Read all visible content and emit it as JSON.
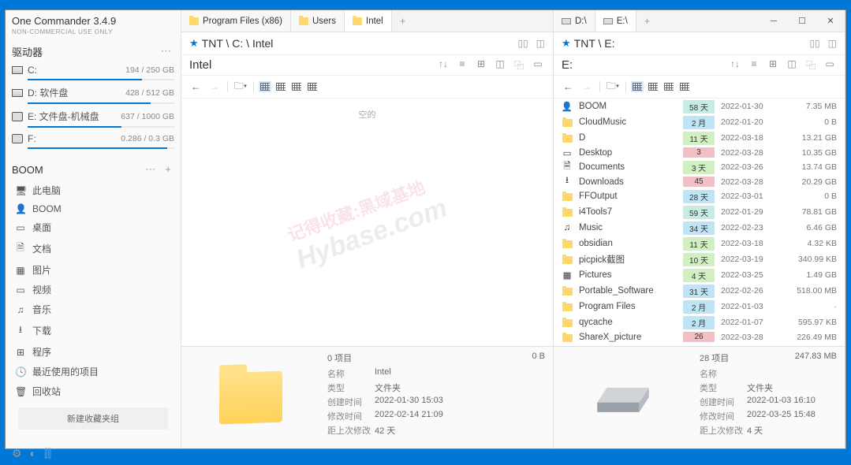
{
  "app": {
    "title": "One Commander 3.4.9",
    "subtitle": "NON-COMMERCIAL USE ONLY"
  },
  "drives": {
    "label": "驱动器",
    "items": [
      {
        "name": "C:",
        "size": "194 / 250 GB",
        "fill": 78
      },
      {
        "name": "D: 软件盘",
        "size": "428 / 512 GB",
        "fill": 84
      },
      {
        "name": "E: 文件盘-机械盘",
        "size": "637 / 1000 GB",
        "fill": 64
      },
      {
        "name": "F:",
        "size": "0.286 / 0.3 GB",
        "fill": 95
      }
    ]
  },
  "favorites": {
    "label": "BOOM",
    "items": [
      {
        "icon": "🖥",
        "label": "此电脑"
      },
      {
        "icon": "👤",
        "label": "BOOM"
      },
      {
        "icon": "▭",
        "label": "桌面"
      },
      {
        "icon": "🗎",
        "label": "文档"
      },
      {
        "icon": "▦",
        "label": "图片"
      },
      {
        "icon": "▭",
        "label": "视频"
      },
      {
        "icon": "♫",
        "label": "音乐"
      },
      {
        "icon": "⭳",
        "label": "下载"
      },
      {
        "icon": "⊞",
        "label": "程序"
      },
      {
        "icon": "🕓",
        "label": "最近使用的项目"
      },
      {
        "icon": "🗑",
        "label": "回收站"
      }
    ],
    "new_group": "新建收藏夹组"
  },
  "left": {
    "tabs": [
      {
        "label": "Program Files (x86)",
        "type": "folder"
      },
      {
        "label": "Users",
        "type": "folder"
      },
      {
        "label": "Intel",
        "type": "folder",
        "active": true
      }
    ],
    "path": "TNT \\ C: \\ Intel",
    "header": "Intel",
    "empty": "空的",
    "info": {
      "count": "0 项目",
      "size_total": "0 B",
      "rows": [
        {
          "k": "名称",
          "v": "Intel"
        },
        {
          "k": "类型",
          "v": "文件夹"
        },
        {
          "k": "创建时间",
          "v": "2022-01-30  15:03"
        },
        {
          "k": "修改时间",
          "v": "2022-02-14  21:09"
        },
        {
          "k": "距上次修改",
          "v": "42 天"
        }
      ]
    }
  },
  "right": {
    "tabs": [
      {
        "label": "D:\\",
        "type": "disk"
      },
      {
        "label": "E:\\",
        "type": "disk",
        "active": true
      }
    ],
    "path": "TNT \\ E:",
    "header": "E:",
    "files": [
      {
        "icon": "👤",
        "name": "BOOM",
        "age": "58 天",
        "agec": "age-cyan",
        "date": "2022-01-30",
        "size": "7.35 MB"
      },
      {
        "icon": "folder",
        "name": "CloudMusic",
        "age": "2 月",
        "agec": "age-blue",
        "date": "2022-01-20",
        "size": "0 B"
      },
      {
        "icon": "folder",
        "name": "D",
        "age": "11 天",
        "agec": "age-green",
        "date": "2022-03-18",
        "size": "13.21 GB"
      },
      {
        "icon": "▭",
        "name": "Desktop",
        "age": "3",
        "agec": "age-red",
        "date": "2022-03-28",
        "size": "10.35 GB"
      },
      {
        "icon": "🗎",
        "name": "Documents",
        "age": "3 天",
        "agec": "age-green",
        "date": "2022-03-26",
        "size": "13.74 GB"
      },
      {
        "icon": "⭳",
        "name": "Downloads",
        "age": "45",
        "agec": "age-red",
        "date": "2022-03-28",
        "size": "20.29 GB"
      },
      {
        "icon": "folder",
        "name": "FFOutput",
        "age": "28 天",
        "agec": "age-blue",
        "date": "2022-03-01",
        "size": "0 B"
      },
      {
        "icon": "folder",
        "name": "i4Tools7",
        "age": "59 天",
        "agec": "age-cyan",
        "date": "2022-01-29",
        "size": "78.81 GB"
      },
      {
        "icon": "♫",
        "name": "Music",
        "age": "34 天",
        "agec": "age-blue",
        "date": "2022-02-23",
        "size": "6.46 GB"
      },
      {
        "icon": "folder",
        "name": "obsidian",
        "age": "11 天",
        "agec": "age-green",
        "date": "2022-03-18",
        "size": "4.32 KB"
      },
      {
        "icon": "folder",
        "name": "picpick截图",
        "age": "10 天",
        "agec": "age-green",
        "date": "2022-03-19",
        "size": "340.99 KB"
      },
      {
        "icon": "▦",
        "name": "Pictures",
        "age": "4 天",
        "agec": "age-green",
        "date": "2022-03-25",
        "size": "1.49 GB"
      },
      {
        "icon": "folder",
        "name": "Portable_Software",
        "age": "31 天",
        "agec": "age-blue",
        "date": "2022-02-26",
        "size": "518.00 MB"
      },
      {
        "icon": "folder",
        "name": "Program Files",
        "age": "2 月",
        "agec": "age-blue",
        "date": "2022-01-03",
        "size": "·"
      },
      {
        "icon": "folder",
        "name": "qycache",
        "age": "2 月",
        "agec": "age-blue",
        "date": "2022-01-07",
        "size": "595.97 KB"
      },
      {
        "icon": "folder",
        "name": "ShareX_picture",
        "age": "26",
        "agec": "age-red",
        "date": "2022-03-28",
        "size": "226.49 MB"
      }
    ],
    "info": {
      "count": "28 项目",
      "size_total": "247.83 MB",
      "rows": [
        {
          "k": "名称",
          "v": ""
        },
        {
          "k": "类型",
          "v": "文件夹"
        },
        {
          "k": "创建时间",
          "v": "2022-01-03  16:10"
        },
        {
          "k": "修改时间",
          "v": "2022-03-25  15:48"
        },
        {
          "k": "距上次修改",
          "v": "4 天"
        }
      ]
    }
  },
  "watermark": {
    "t1": "记得收藏:黑域基地",
    "t2": "Hybase.com"
  }
}
